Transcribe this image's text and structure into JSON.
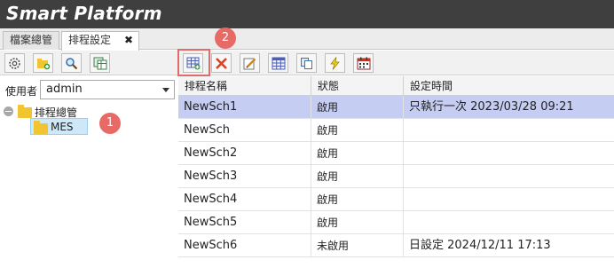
{
  "app": {
    "title": "Smart Platform"
  },
  "tabs": [
    {
      "label": "檔案總管"
    },
    {
      "label": "排程設定",
      "close": "✖"
    }
  ],
  "left_toolbar": {
    "icons": [
      "settings-icon",
      "add-folder-icon",
      "search-icon",
      "copy-sheet-icon"
    ]
  },
  "right_toolbar": {
    "icons": [
      "add-schedule-icon",
      "delete-icon",
      "edit-icon",
      "calendar-grid-icon",
      "copy-icon",
      "run-icon",
      "calendar-icon"
    ],
    "accent": "#e06b6b"
  },
  "badges": {
    "one": "1",
    "two": "2"
  },
  "user": {
    "label": "使用者",
    "value": "admin"
  },
  "tree": {
    "root": "排程總管",
    "child": "MES"
  },
  "grid": {
    "columns": [
      "排程名稱",
      "狀態",
      "設定時間"
    ],
    "rows": [
      {
        "name": "NewSch1",
        "status": "啟用",
        "time": "只執行一次 2023/03/28 09:21",
        "selected": true
      },
      {
        "name": "NewSch",
        "status": "啟用",
        "time": ""
      },
      {
        "name": "NewSch2",
        "status": "啟用",
        "time": ""
      },
      {
        "name": "NewSch3",
        "status": "啟用",
        "time": ""
      },
      {
        "name": "NewSch4",
        "status": "啟用",
        "time": ""
      },
      {
        "name": "NewSch5",
        "status": "啟用",
        "time": ""
      },
      {
        "name": "NewSch6",
        "status": "未啟用",
        "time": "日設定 2024/12/11 17:13"
      }
    ]
  }
}
